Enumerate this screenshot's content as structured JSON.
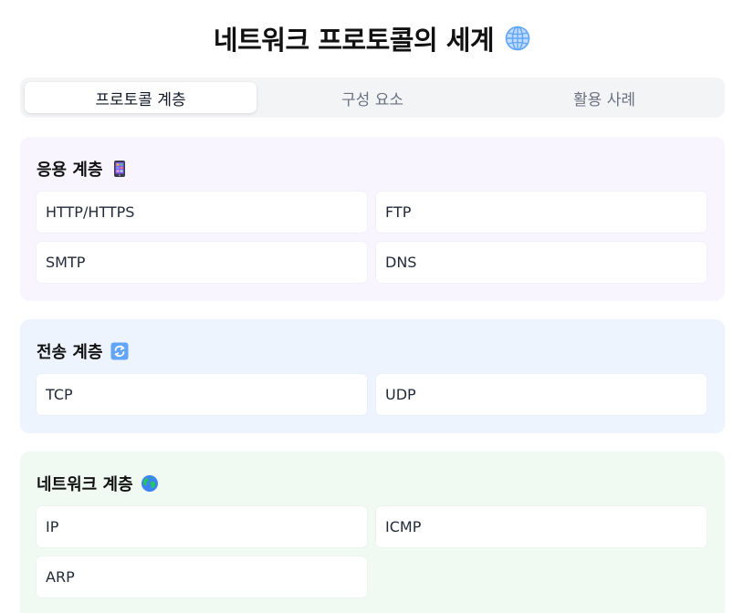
{
  "header": {
    "title": "네트워크 프로토콜의 세계",
    "icon": "globe-icon"
  },
  "tabs": [
    {
      "label": "프로토콜 계층",
      "active": true
    },
    {
      "label": "구성 요소",
      "active": false
    },
    {
      "label": "활용 사례",
      "active": false
    }
  ],
  "sections": [
    {
      "title": "응용 계층",
      "icon": "mobile-phone-icon",
      "color": "#f8f5fe",
      "items": [
        "HTTP/HTTPS",
        "FTP",
        "SMTP",
        "DNS"
      ]
    },
    {
      "title": "전송 계층",
      "icon": "refresh-icon",
      "color": "#eef4fe",
      "items": [
        "TCP",
        "UDP"
      ]
    },
    {
      "title": "네트워크 계층",
      "icon": "earth-globe-icon",
      "color": "#f0faf3",
      "items": [
        "IP",
        "ICMP",
        "ARP"
      ]
    }
  ]
}
